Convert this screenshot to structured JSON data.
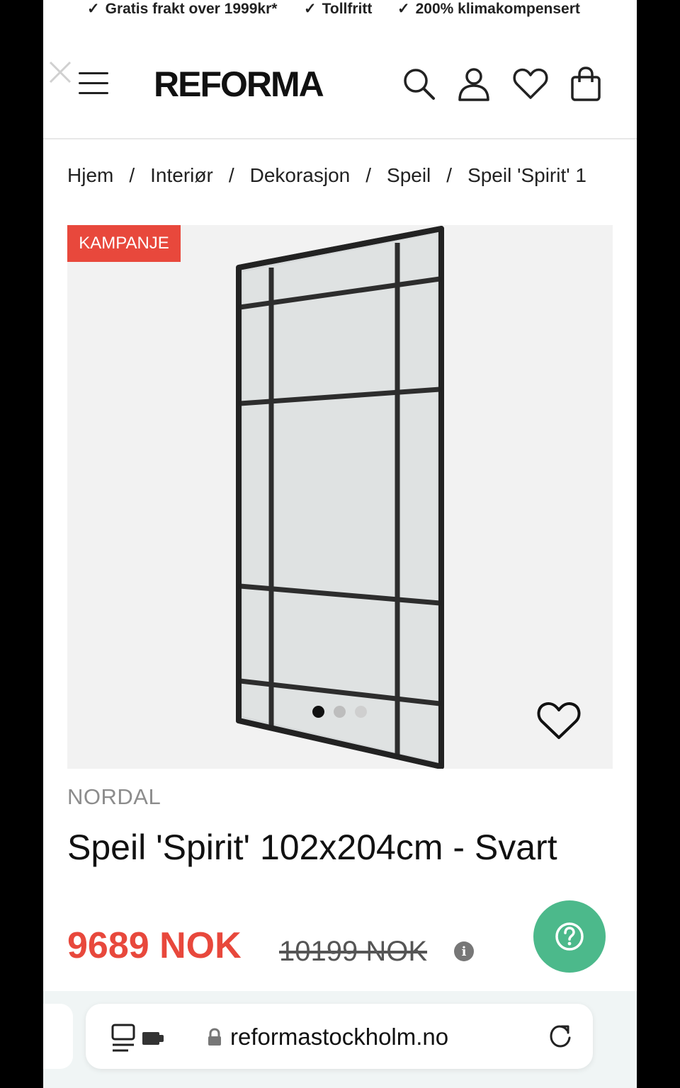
{
  "usps": [
    "Gratis frakt over 1999kr*",
    "Tollfritt",
    "200% klimakompensert"
  ],
  "brand_logo": "REFORMA",
  "breadcrumb": [
    "Hjem",
    "Interiør",
    "Dekorasjon",
    "Speil",
    "Speil 'Spirit' 1"
  ],
  "badge": "KAMPANJE",
  "gallery": {
    "image_count": 3,
    "active_index": 0
  },
  "product": {
    "brand": "NORDAL",
    "title": "Speil 'Spirit' 102x204cm - Svart",
    "price": "9689 NOK",
    "old_price": "10199 NOK",
    "info_glyph": "i"
  },
  "browser": {
    "url": "reformastockholm.no"
  },
  "colors": {
    "sale_red": "#e8483c",
    "help_green": "#4cb98b"
  }
}
